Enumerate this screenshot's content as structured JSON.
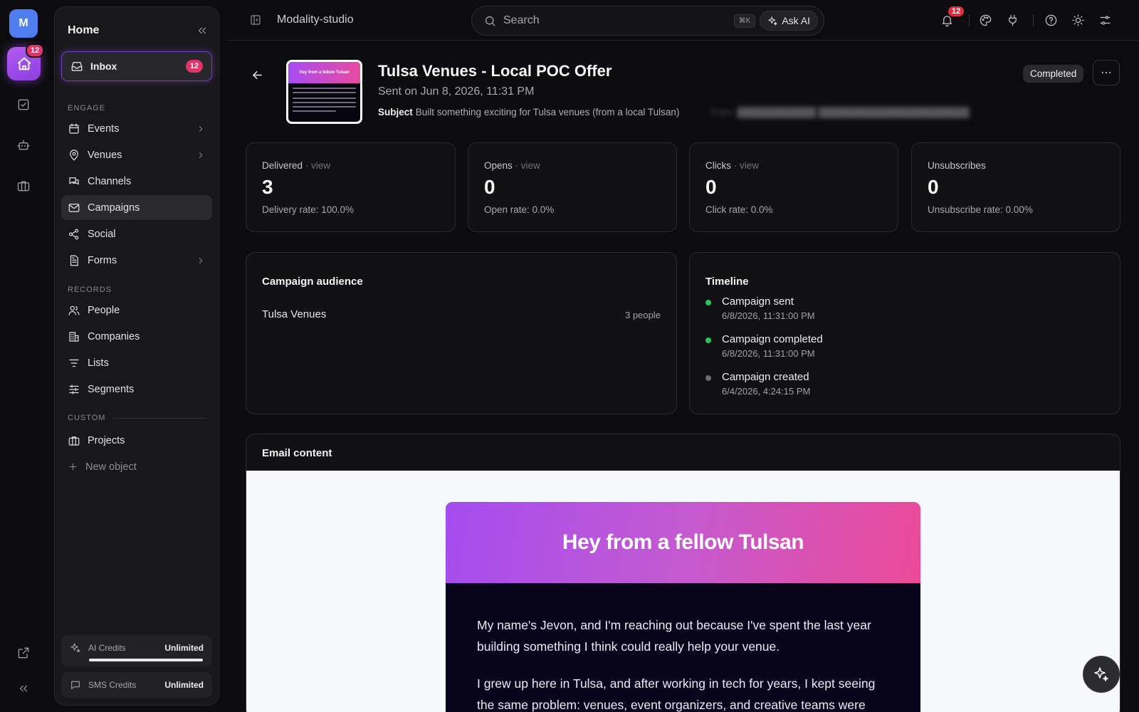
{
  "rail": {
    "avatar_letter": "M",
    "home_badge": "12"
  },
  "sidebar": {
    "title": "Home",
    "inbox": {
      "label": "Inbox",
      "count": "12"
    },
    "sections": {
      "engage": "ENGAGE",
      "records": "RECORDS",
      "custom": "CUSTOM"
    },
    "items": {
      "events": "Events",
      "venues": "Venues",
      "channels": "Channels",
      "campaigns": "Campaigns",
      "social": "Social",
      "forms": "Forms",
      "people": "People",
      "companies": "Companies",
      "lists": "Lists",
      "segments": "Segments",
      "projects": "Projects",
      "new_object": "New object"
    },
    "credits": {
      "ai_label": "AI Credits",
      "ai_value": "Unlimited",
      "ai_fill_fraction": 1.0,
      "sms_label": "SMS Credits",
      "sms_value": "Unlimited"
    }
  },
  "topbar": {
    "breadcrumb": "Modality-studio",
    "search_placeholder": "Search",
    "shortcut": "⌘K",
    "ask_ai": "Ask AI",
    "notification_count": "12"
  },
  "campaign": {
    "title": "Tulsa Venues - Local POC Offer",
    "sent": "Sent on Jun 8, 2026, 11:31 PM",
    "subject_label": "Subject",
    "subject": "Built something exciting for Tulsa venues (from a local Tulsan)",
    "status": "Completed",
    "thumbnail_heading": "Hey from a fellow Tulsan"
  },
  "stats": {
    "delivered": {
      "label": "Delivered",
      "view": "· view",
      "value": "3",
      "rate": "Delivery rate: 100.0%"
    },
    "opens": {
      "label": "Opens",
      "view": "· view",
      "value": "0",
      "rate": "Open rate: 0.0%"
    },
    "clicks": {
      "label": "Clicks",
      "view": "· view",
      "value": "0",
      "rate": "Click rate: 0.0%"
    },
    "unsubscribes": {
      "label": "Unsubscribes",
      "value": "0",
      "rate": "Unsubscribe rate: 0.00%"
    }
  },
  "audience": {
    "title": "Campaign audience",
    "name": "Tulsa Venues",
    "count": "3 people"
  },
  "timeline": {
    "title": "Timeline",
    "events": [
      {
        "title": "Campaign sent",
        "date": "6/8/2026, 11:31:00 PM",
        "color": "#22c55e"
      },
      {
        "title": "Campaign completed",
        "date": "6/8/2026, 11:31:00 PM",
        "color": "#22c55e"
      },
      {
        "title": "Campaign created",
        "date": "6/4/2026, 4:24:15 PM",
        "color": "#6b6b72"
      }
    ]
  },
  "email": {
    "section_title": "Email content",
    "heading": "Hey from a fellow Tulsan",
    "p1": "My name's Jevon, and I'm reaching out because I've spent the last year building something I think could really help your venue.",
    "p2": "I grew up here in Tulsa, and after working in tech for years, I kept seeing the same problem: venues, event organizers, and creative teams were"
  },
  "colors": {
    "accent": "#a855f7",
    "badge": "#e0336a",
    "success": "#22c55e"
  }
}
